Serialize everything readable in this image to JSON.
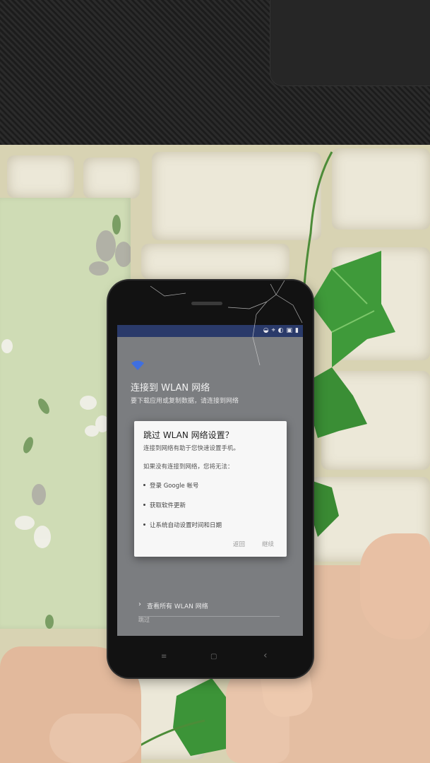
{
  "scene": {
    "description_colors": {
      "mat": "#1f1f1f",
      "wall": "#d8d3b3",
      "cloth": "#cfdcb5",
      "leaf": "#3f9a3a",
      "skin": "#e6bfa5"
    }
  },
  "phone": {
    "status_icons": [
      "signal-icon",
      "location-icon",
      "data-saver-icon",
      "sim-icon",
      "battery-icon"
    ],
    "setup": {
      "title": "连接到 WLAN 网络",
      "subtitle": "要下载应用或复制数据，请连接到网络",
      "view_all": "查看所有 WLAN 网络",
      "skip": "跳过"
    },
    "dialog": {
      "title": "跳过 WLAN 网络设置？",
      "message": "连接到网络有助于您快速设置手机。",
      "intro": "如果没有连接到网络，您将无法：",
      "bullets": [
        "登录 Google 帐号",
        "获取软件更新",
        "让系统自动设置时间和日期"
      ],
      "back_button": "返回",
      "continue_button": "继续"
    },
    "nav": {
      "menu": "≡",
      "home": "▢",
      "back": "‹"
    }
  }
}
